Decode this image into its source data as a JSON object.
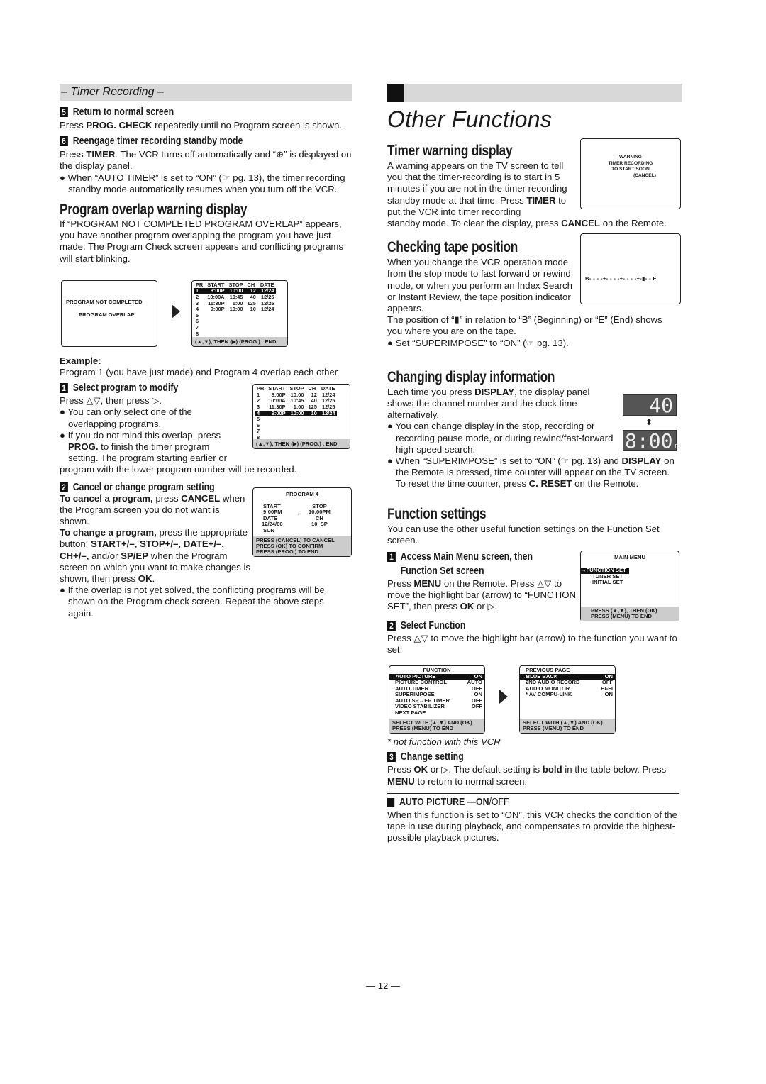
{
  "left": {
    "section_bar": "– Timer Recording –",
    "step5": {
      "num": "5",
      "title": "Return to normal screen",
      "text_pre": "Press ",
      "text_bold": "PROG. CHECK",
      "text_post": " repeatedly until no Program screen is shown."
    },
    "step6": {
      "num": "6",
      "title": "Reengage timer recording standby mode",
      "text_pre": "Press ",
      "text_bold": "TIMER",
      "text_post": ". The VCR turns off automatically and “⊕” is displayed on the display panel.",
      "bullet": "When “AUTO TIMER” is set to “ON” (☞ pg. 13), the timer recording standby mode automatically resumes when you turn off the VCR."
    },
    "overlap": {
      "heading": "Program overlap warning display",
      "text": "If “PROGRAM NOT COMPLETED PROGRAM OVERLAP” appears, you have another program overlapping the program you have just made. The Program Check screen appears and conflicting programs will start blinking.",
      "warning_screen": {
        "line1": "PROGRAM NOT COMPLETED",
        "line2": "PROGRAM OVERLAP"
      },
      "example_label": "Example:",
      "example_text": "Program 1 (you have just made) and Program 4 overlap each other"
    },
    "program_table": {
      "headers": [
        "PR",
        "START",
        "STOP",
        "CH",
        "DATE"
      ],
      "rows": [
        [
          "1",
          "8:00P",
          "10:00",
          "12",
          "12/24"
        ],
        [
          "2",
          "10:00A",
          "10:45",
          "40",
          "12/25"
        ],
        [
          "3",
          "11:30P",
          "1:00",
          "125",
          "12/25"
        ],
        [
          "4",
          "9:00P",
          "10:00",
          "10",
          "12/24"
        ],
        [
          "5",
          "",
          "",
          "",
          ""
        ],
        [
          "6",
          "",
          "",
          "",
          ""
        ],
        [
          "7",
          "",
          "",
          "",
          ""
        ],
        [
          "8",
          "",
          "",
          "",
          ""
        ]
      ],
      "footer": "(▲,▼), THEN (▶)  (PROG.) : END"
    },
    "step1": {
      "num": "1",
      "title": "Select program to modify",
      "text": "Press △▽, then press ▷.",
      "bullet1": "You can only select one of the overlapping programs.",
      "bullet2_pre": "If you do not mind this overlap, press ",
      "bullet2_bold": "PROG.",
      "bullet2_post": " to finish the timer program setting. The program starting earlier or program with the lower program number will be recorded."
    },
    "step2": {
      "num": "2",
      "title": "Cancel or change program setting",
      "cancel_bold": "To cancel a program,",
      "cancel_mid": " press ",
      "cancel_key": "CANCEL",
      "cancel_post": " when the Program screen you do not want is shown.",
      "change_bold": "To change a program,",
      "change_mid": " press the appropriate button: ",
      "change_keys": "START+/–, STOP+/–, DATE+/–, CH+/–,",
      "change_and": " and/or ",
      "change_sp": "SP/EP",
      "change_post": " when the Program screen on which you want to make changes is shown, then press ",
      "change_ok": "OK",
      "change_end": ".",
      "bullet": "If the overlap is not yet solved, the conflicting programs will be shown on the Program check screen. Repeat the above steps again."
    },
    "program4_screen": {
      "title": "PROGRAM 4",
      "start_label": "START",
      "start_value": "9:00PM",
      "stop_label": "STOP",
      "stop_value": "10:00PM",
      "date_label": "DATE",
      "date_value": "12/24/00",
      "day": "SUN",
      "ch_label": "CH",
      "ch_value": "10",
      "speed": "SP",
      "footer1": "PRESS (CANCEL) TO CANCEL",
      "footer2": "PRESS (OK) TO CONFIRM",
      "footer3": "PRESS (PROG.) TO END"
    }
  },
  "right": {
    "title": "Other Functions",
    "timer_warning": {
      "heading": "Timer warning display",
      "text_a": "A warning appears on the TV screen to tell you that the timer-recording is to start in 5 minutes if you are not in the timer recording standby mode at that time. Press ",
      "text_bold": "TIMER",
      "text_b": " to put the VCR into timer recording standby mode. To clear the display, press ",
      "text_bold2": "CANCEL",
      "text_c": " on the Remote.",
      "screen": {
        "line1": "–WARNING–",
        "line2": "TIMER RECORDING",
        "line3": "TO START SOON",
        "line4": "(CANCEL)"
      }
    },
    "tape_position": {
      "heading": "Checking tape position",
      "text": "When you change the VCR operation mode from the stop mode to fast forward or rewind mode, or when you perform an Index Search or Instant Review, the tape position indicator appears.",
      "text2": "The position of “▮” in relation to “B” (Beginning) or “E” (End) shows you where you are on the tape.",
      "bullet": "Set “SUPERIMPOSE” to “ON” (☞ pg. 13).",
      "indicator": "B- - - -+- - - -+- - - -+-▮- - E",
      "position_fraction": 0.85
    },
    "display_info": {
      "heading": "Changing display information",
      "text_pre": "Each time you press ",
      "text_bold": "DISPLAY",
      "text_post": ", the display panel shows the channel number and the clock time alternatively.",
      "bullet1": "You can change display in the stop, recording or recording pause mode, or during rewind/fast-forward high-speed search.",
      "bullet2_pre": "When “SUPERIMPOSE” is set to “ON” (☞ pg. 13) and ",
      "bullet2_bold": "DISPLAY",
      "bullet2_mid": " on the Remote is pressed, time counter will appear on the TV screen. To reset the time counter, press ",
      "bullet2_bold2": "C. RESET",
      "bullet2_post": " on the Remote.",
      "lcd_channel": "40",
      "lcd_time": "8:00",
      "lcd_pm": "PM"
    },
    "function_settings": {
      "heading": "Function settings",
      "text": "You can use the other useful function settings on the Function Set screen.",
      "step1": {
        "num": "1",
        "title1": "Access Main Menu screen, then",
        "title2": "Function Set screen",
        "text_pre": "Press ",
        "text_bold": "MENU",
        "text_mid": " on the Remote. Press △▽ to move the highlight bar (arrow) to “FUNCTION SET”, then press ",
        "text_bold2": "OK",
        "text_post": " or ▷."
      },
      "main_menu": {
        "title": "MAIN MENU",
        "items": [
          "→FUNCTION SET",
          "TUNER SET",
          "INITIAL SET"
        ],
        "footer1": "PRESS (▲,▼), THEN (OK)",
        "footer2": "PRESS (MENU) TO END"
      },
      "step2": {
        "num": "2",
        "title": "Select Function",
        "text": "Press △▽ to move the highlight bar (arrow) to the function you want to set."
      },
      "function_screen": {
        "title": "FUNCTION",
        "items": [
          {
            "label": "→AUTO PICTURE",
            "value": "ON"
          },
          {
            "label": "PICTURE CONTROL",
            "value": "AUTO"
          },
          {
            "label": "AUTO TIMER",
            "value": "OFF"
          },
          {
            "label": "SUPERIMPOSE",
            "value": "ON"
          },
          {
            "label": "AUTO SP→EP TIMER",
            "value": "OFF"
          },
          {
            "label": "VIDEO STABILIZER",
            "value": "OFF"
          },
          {
            "label": "NEXT PAGE",
            "value": ""
          }
        ],
        "footer1": "SELECT WITH (▲,▼) AND (OK)",
        "footer2": "PRESS (MENU) TO END"
      },
      "function_screen2": {
        "title": "PREVIOUS PAGE",
        "items": [
          {
            "label": "→BLUE BACK",
            "value": "ON"
          },
          {
            "label": "2ND AUDIO RECORD",
            "value": "OFF"
          },
          {
            "label": "AUDIO MONITOR",
            "value": "HI-FI"
          },
          {
            "label": "* AV COMPU-LINK",
            "value": "ON"
          }
        ],
        "footer1": "SELECT WITH (▲,▼) AND (OK)",
        "footer2": "PRESS (MENU) TO END"
      },
      "footnote": "* not function with this VCR",
      "step3": {
        "num": "3",
        "title": "Change setting",
        "text_pre": "Press ",
        "text_bold": "OK",
        "text_mid": " or ▷. The default setting is ",
        "text_bold2": "bold",
        "text_mid2": " in the table below. Press ",
        "text_bold3": "MENU",
        "text_post": " to return to normal screen."
      },
      "auto_picture": {
        "heading_a": "AUTO PICTURE — ",
        "heading_on": "ON",
        "heading_off": "/OFF",
        "text": "When this function is set to “ON”, this VCR checks the condition of the tape in use during playback, and compensates to provide the highest-possible playback pictures."
      }
    }
  },
  "page_number": "— 12 —"
}
